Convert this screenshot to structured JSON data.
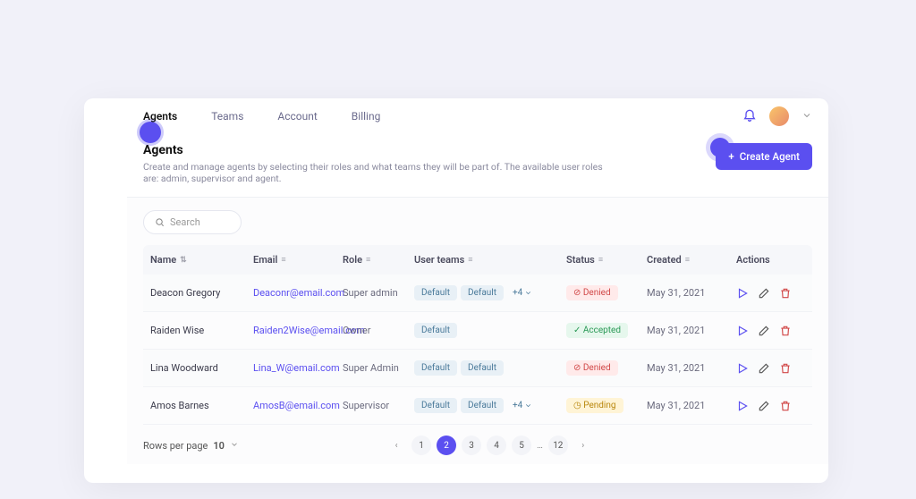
{
  "tabs": [
    "Agents",
    "Teams",
    "Account",
    "Billing"
  ],
  "activeTab": 0,
  "page": {
    "title": "Agents",
    "subtitle": "Create and manage agents by selecting their roles and what teams they will be part of. The available user roles are: admin, supervisor and agent."
  },
  "createBtn": "Create Agent",
  "search": {
    "placeholder": "Search"
  },
  "columns": [
    "Name",
    "Email",
    "Role",
    "User teams",
    "Status",
    "Created",
    "Actions"
  ],
  "rows": [
    {
      "name": "Deacon Gregory",
      "email": "Deaconr@email.com",
      "role": "Super admin",
      "teams": [
        "Default",
        "Default"
      ],
      "more": "+4",
      "status": "Denied",
      "statusType": "denied",
      "created": "May 31, 2021"
    },
    {
      "name": "Raiden Wise",
      "email": "Raiden2Wise@email.com",
      "role": "Owner",
      "teams": [
        "Default"
      ],
      "more": "",
      "status": "Accepted",
      "statusType": "accepted",
      "created": "May 31, 2021"
    },
    {
      "name": "Lina Woodward",
      "email": "Lina_W@email.com",
      "role": "Super Admin",
      "teams": [
        "Default",
        "Default"
      ],
      "more": "",
      "status": "Denied",
      "statusType": "denied",
      "created": "May 31, 2021"
    },
    {
      "name": "Amos Barnes",
      "email": "AmosB@email.com",
      "role": "Supervisor",
      "teams": [
        "Default",
        "Default"
      ],
      "more": "+4",
      "status": "Pending",
      "statusType": "pending",
      "created": "May 31, 2021"
    }
  ],
  "pagination": {
    "rowsLabel": "Rows per page",
    "rowsValue": "10",
    "pages": [
      "1",
      "2",
      "3",
      "4",
      "5",
      "...",
      "12"
    ],
    "active": 1
  },
  "sidebarIcons": [
    "home",
    "chat",
    "users",
    "chart",
    "calendar",
    "megaphone",
    "flow",
    "code",
    "gear"
  ]
}
